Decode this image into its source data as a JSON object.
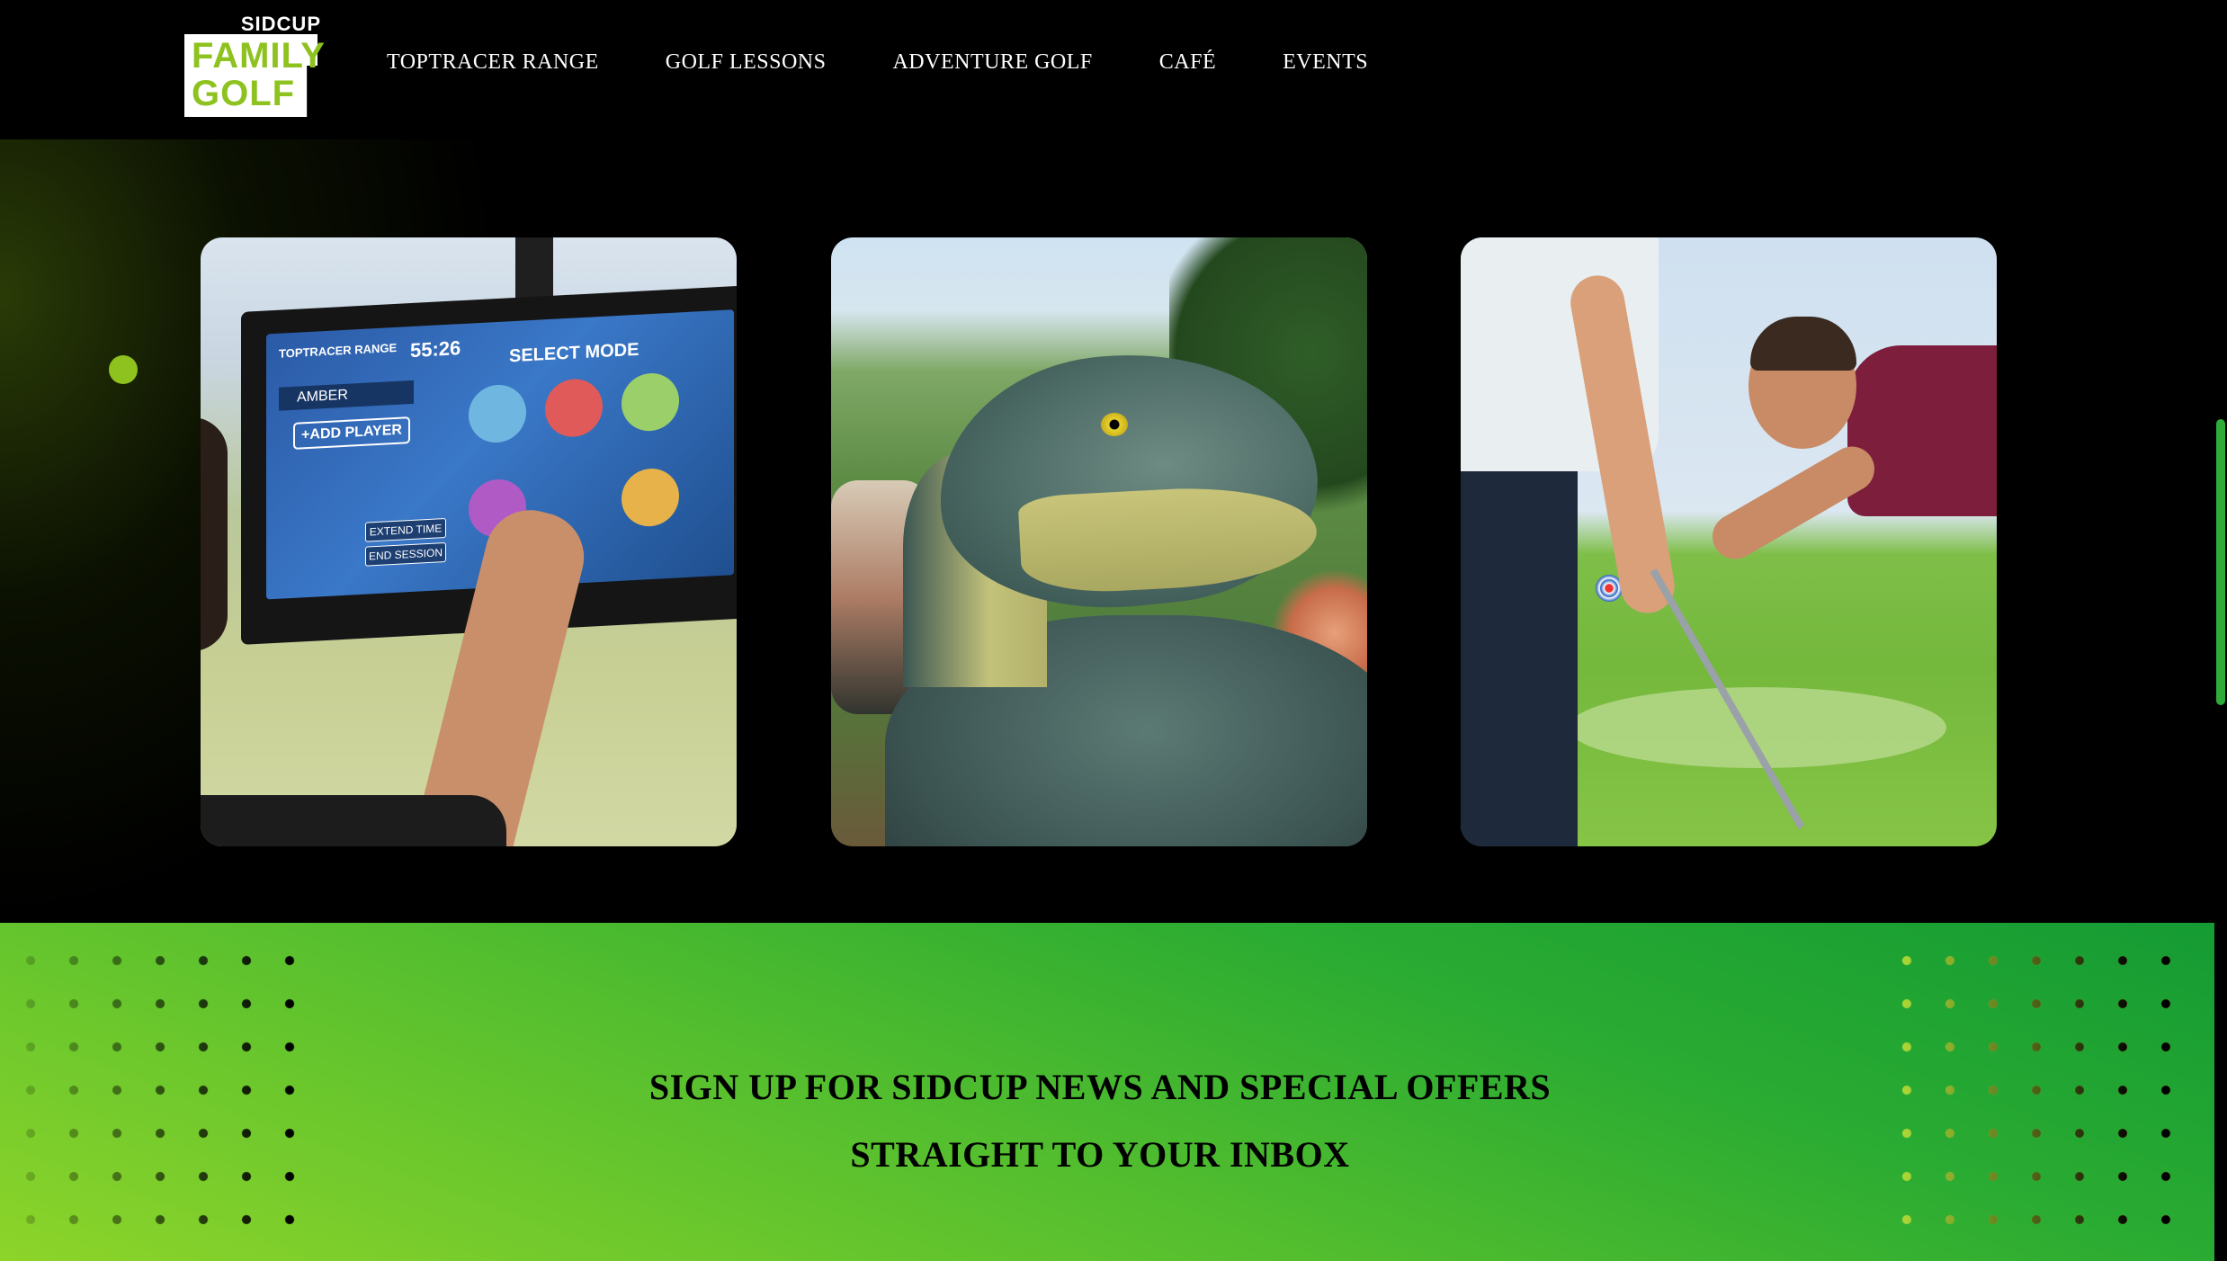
{
  "brand": {
    "logo_top": "SIDCUP",
    "logo_line1": "FAMILY",
    "logo_line2": "GOLF",
    "accent_color": "#8dc21f"
  },
  "nav": {
    "items": [
      {
        "label": "TOPTRACER RANGE"
      },
      {
        "label": "GOLF LESSONS"
      },
      {
        "label": "ADVENTURE GOLF"
      },
      {
        "label": "CAFÉ"
      },
      {
        "label": "EVENTS"
      }
    ]
  },
  "gallery": {
    "cards": [
      {
        "subject": "toptracer-screen",
        "screen": {
          "brand": "TOPTRACER RANGE",
          "timer": "55:26",
          "title": "SELECT MODE",
          "player": "AMBER",
          "add_player": "+ADD PLAYER",
          "extend": "EXTEND TIME",
          "end": "END SESSION"
        }
      },
      {
        "subject": "adventure-golf-dinosaur"
      },
      {
        "subject": "golf-lesson"
      }
    ]
  },
  "newsletter": {
    "line1": "SIGN UP FOR SIDCUP NEWS AND SPECIAL OFFERS",
    "line2": "STRAIGHT TO YOUR INBOX",
    "gradient_start": "#8dd42a",
    "gradient_end": "#149b33"
  },
  "scrollbar": {
    "thumb_color": "#2eab38"
  }
}
